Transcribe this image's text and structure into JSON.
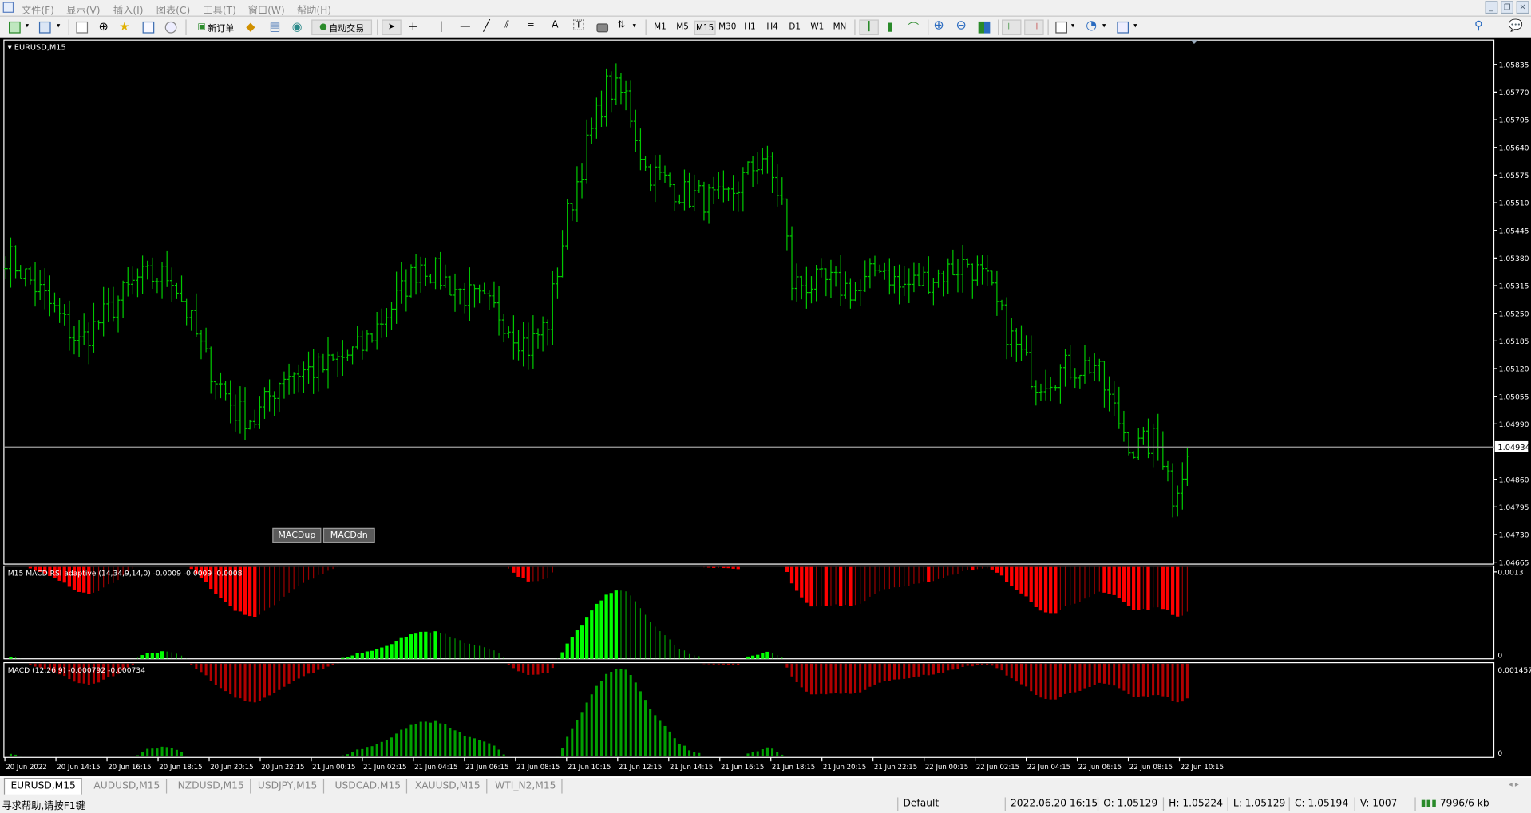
{
  "menu": [
    "文件(F)",
    "显示(V)",
    "插入(I)",
    "图表(C)",
    "工具(T)",
    "窗口(W)",
    "帮助(H)"
  ],
  "toolbar": {
    "new_order": "新订单",
    "auto_trading": "自动交易",
    "timeframes": [
      "M1",
      "M5",
      "M15",
      "M30",
      "H1",
      "H4",
      "D1",
      "W1",
      "MN"
    ],
    "active_timeframe": "M15"
  },
  "chart": {
    "title": "EURUSD,M15",
    "price_ticks": [
      "1.05835",
      "1.05770",
      "1.05705",
      "1.05640",
      "1.05575",
      "1.05510",
      "1.05445",
      "1.05380",
      "1.05315",
      "1.05250",
      "1.05185",
      "1.05120",
      "1.05055",
      "1.04990",
      "1.04860",
      "1.04795",
      "1.04730",
      "1.04665"
    ],
    "price_range": [
      1.04665,
      1.05835
    ],
    "current_price": "1.04934",
    "bar_color": "#00c800",
    "price_waypoints": [
      [
        0,
        1.0539
      ],
      [
        7,
        1.053
      ],
      [
        15,
        1.0518
      ],
      [
        27,
        1.0533
      ],
      [
        34,
        1.0534
      ],
      [
        41,
        1.0514
      ],
      [
        47,
        1.0502
      ],
      [
        51,
        1.05
      ],
      [
        57,
        1.0511
      ],
      [
        65,
        1.0512
      ],
      [
        73,
        1.0517
      ],
      [
        81,
        1.053
      ],
      [
        85,
        1.0537
      ],
      [
        93,
        1.053
      ],
      [
        101,
        1.0525
      ],
      [
        107,
        1.0517
      ],
      [
        111,
        1.0523
      ],
      [
        115,
        1.0548
      ],
      [
        119,
        1.0564
      ],
      [
        123,
        1.0578
      ],
      [
        127,
        1.0576
      ],
      [
        131,
        1.0559
      ],
      [
        139,
        1.0553
      ],
      [
        147,
        1.0551
      ],
      [
        155,
        1.0562
      ],
      [
        159,
        1.0551
      ],
      [
        161,
        1.0532
      ],
      [
        169,
        1.0532
      ],
      [
        175,
        1.053
      ],
      [
        179,
        1.0537
      ],
      [
        183,
        1.0531
      ],
      [
        191,
        1.0534
      ],
      [
        197,
        1.0537
      ],
      [
        201,
        1.0532
      ],
      [
        205,
        1.0521
      ],
      [
        211,
        1.0509
      ],
      [
        217,
        1.0512
      ],
      [
        223,
        1.0513
      ],
      [
        227,
        1.0502
      ],
      [
        231,
        1.0493
      ],
      [
        235,
        1.0495
      ],
      [
        238,
        1.049
      ],
      [
        239,
        1.0479
      ],
      [
        240,
        1.0485
      ],
      [
        242,
        1.0493
      ]
    ],
    "buttons": [
      "MACDup",
      "MACDdn"
    ],
    "time_labels": [
      "20 Jun 2022",
      "20 Jun 14:15",
      "20 Jun 16:15",
      "20 Jun 18:15",
      "20 Jun 20:15",
      "20 Jun 22:15",
      "21 Jun 00:15",
      "21 Jun 02:15",
      "21 Jun 04:15",
      "21 Jun 06:15",
      "21 Jun 08:15",
      "21 Jun 10:15",
      "21 Jun 12:15",
      "21 Jun 14:15",
      "21 Jun 16:15",
      "21 Jun 18:15",
      "21 Jun 20:15",
      "21 Jun 22:15",
      "22 Jun 00:15",
      "22 Jun 02:15",
      "22 Jun 04:15",
      "22 Jun 06:15",
      "22 Jun 08:15",
      "22 Jun 10:15"
    ]
  },
  "indicator1": {
    "label": "M15 MACD RSI adaptive (14,34,9,14,0) -0.0009 -0.0009 -0.0008",
    "max": "0.0013",
    "zero": "0",
    "up_color": "#00ff00",
    "down_color": "#ff0000"
  },
  "indicator2": {
    "label": "MACD (12,26,9) -0.000792 -0.000734",
    "max": "0.001457",
    "zero": "0",
    "up_color": "#00a000",
    "down_color": "#b00000"
  },
  "tabs": [
    "EURUSD,M15",
    "AUDUSD,M15",
    "NZDUSD,M15",
    "USDJPY,M15",
    "USDCAD,M15",
    "XAUUSD,M15",
    "WTI_N2,M15"
  ],
  "status": {
    "help": "寻求帮助,请按F1键",
    "profile": "Default",
    "datetime": "2022.06.20 16:15",
    "open": "O: 1.05129",
    "high": "H: 1.05224",
    "low": "L: 1.05129",
    "close": "C: 1.05194",
    "volume": "V: 1007",
    "traffic": "7996/6 kb"
  }
}
